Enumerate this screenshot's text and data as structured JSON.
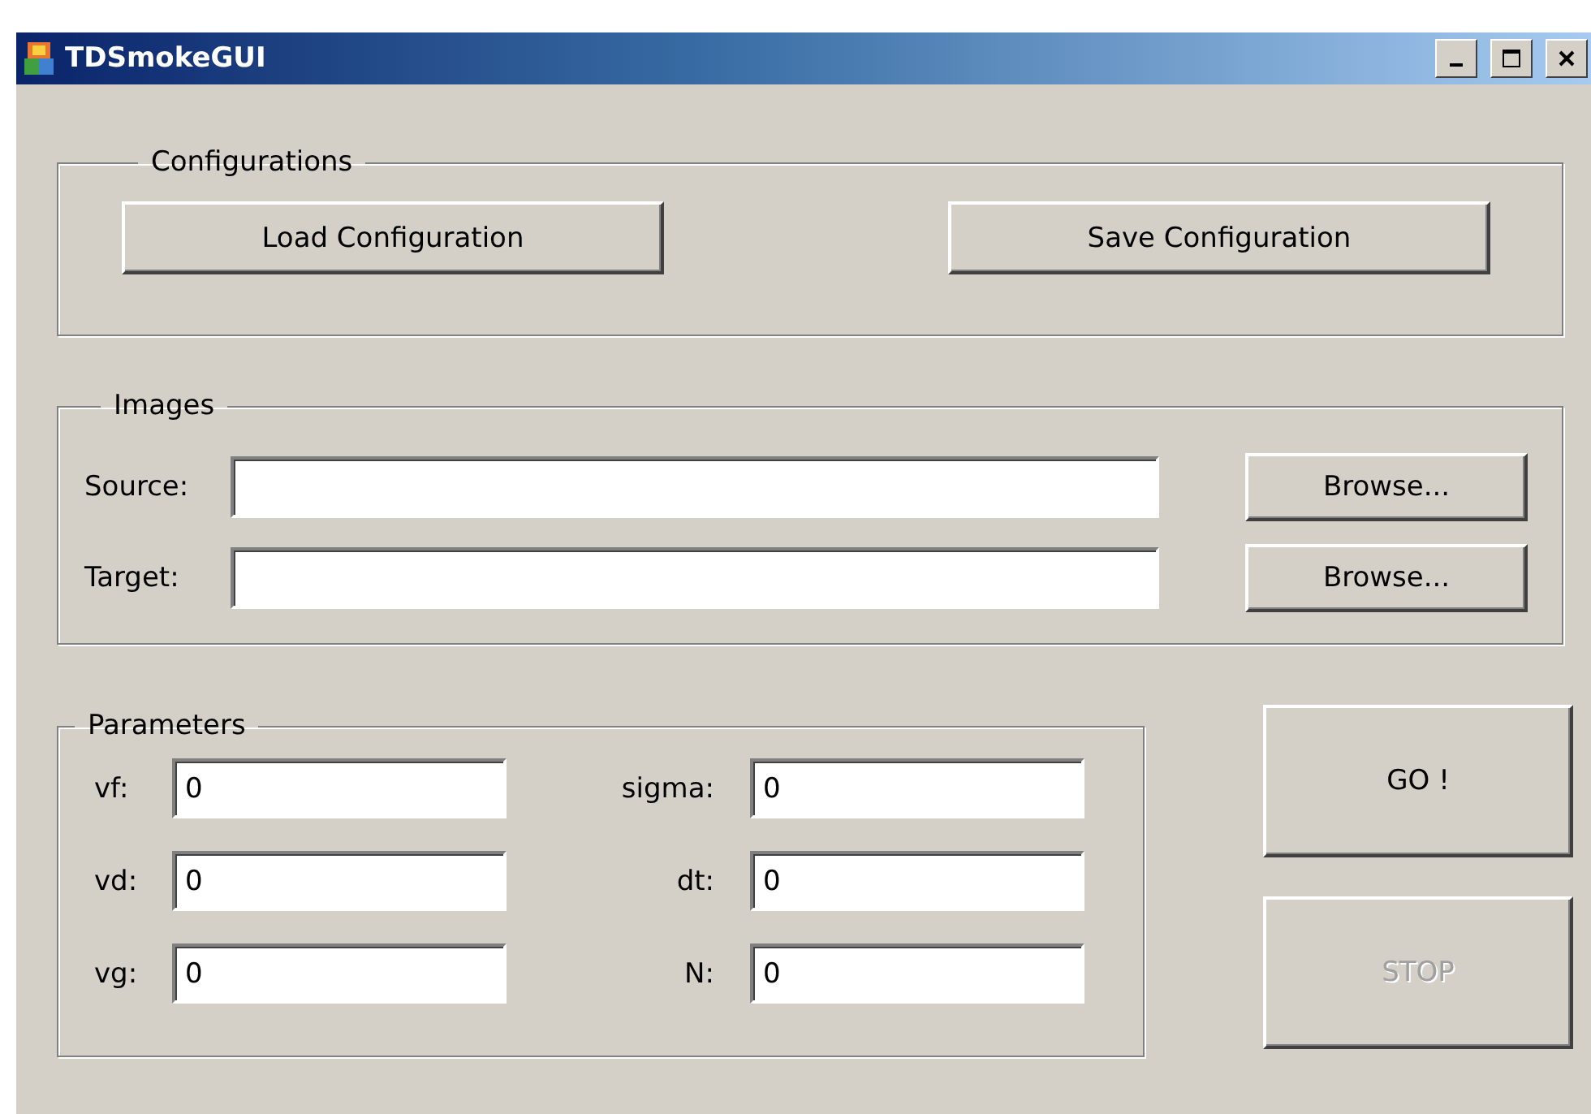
{
  "window": {
    "title": "TDSmokeGUI"
  },
  "configurations": {
    "title": "Configurations",
    "buttons": [
      {
        "label": "Load Configuration",
        "disabled": false
      },
      {
        "label": "Save Configuration",
        "disabled": false
      }
    ]
  },
  "images": {
    "title": "Images",
    "rows": [
      {
        "label": "Source:",
        "button": "Browse..."
      },
      {
        "label": "Target:",
        "button": "Browse..."
      }
    ]
  },
  "parameters": {
    "title": "Parameters",
    "fields": [
      {
        "label": "vf:",
        "value": "0"
      },
      {
        "label": "sigma:",
        "value": "0"
      },
      {
        "label": "vd:",
        "value": "0"
      },
      {
        "label": "dt:",
        "value": "0"
      },
      {
        "label": "vg:",
        "value": "0"
      },
      {
        "label": "N:",
        "value": "0"
      }
    ]
  },
  "actions": [
    {
      "label": "GO !",
      "disabled": false
    },
    {
      "label": "STOP",
      "disabled": true
    }
  ]
}
